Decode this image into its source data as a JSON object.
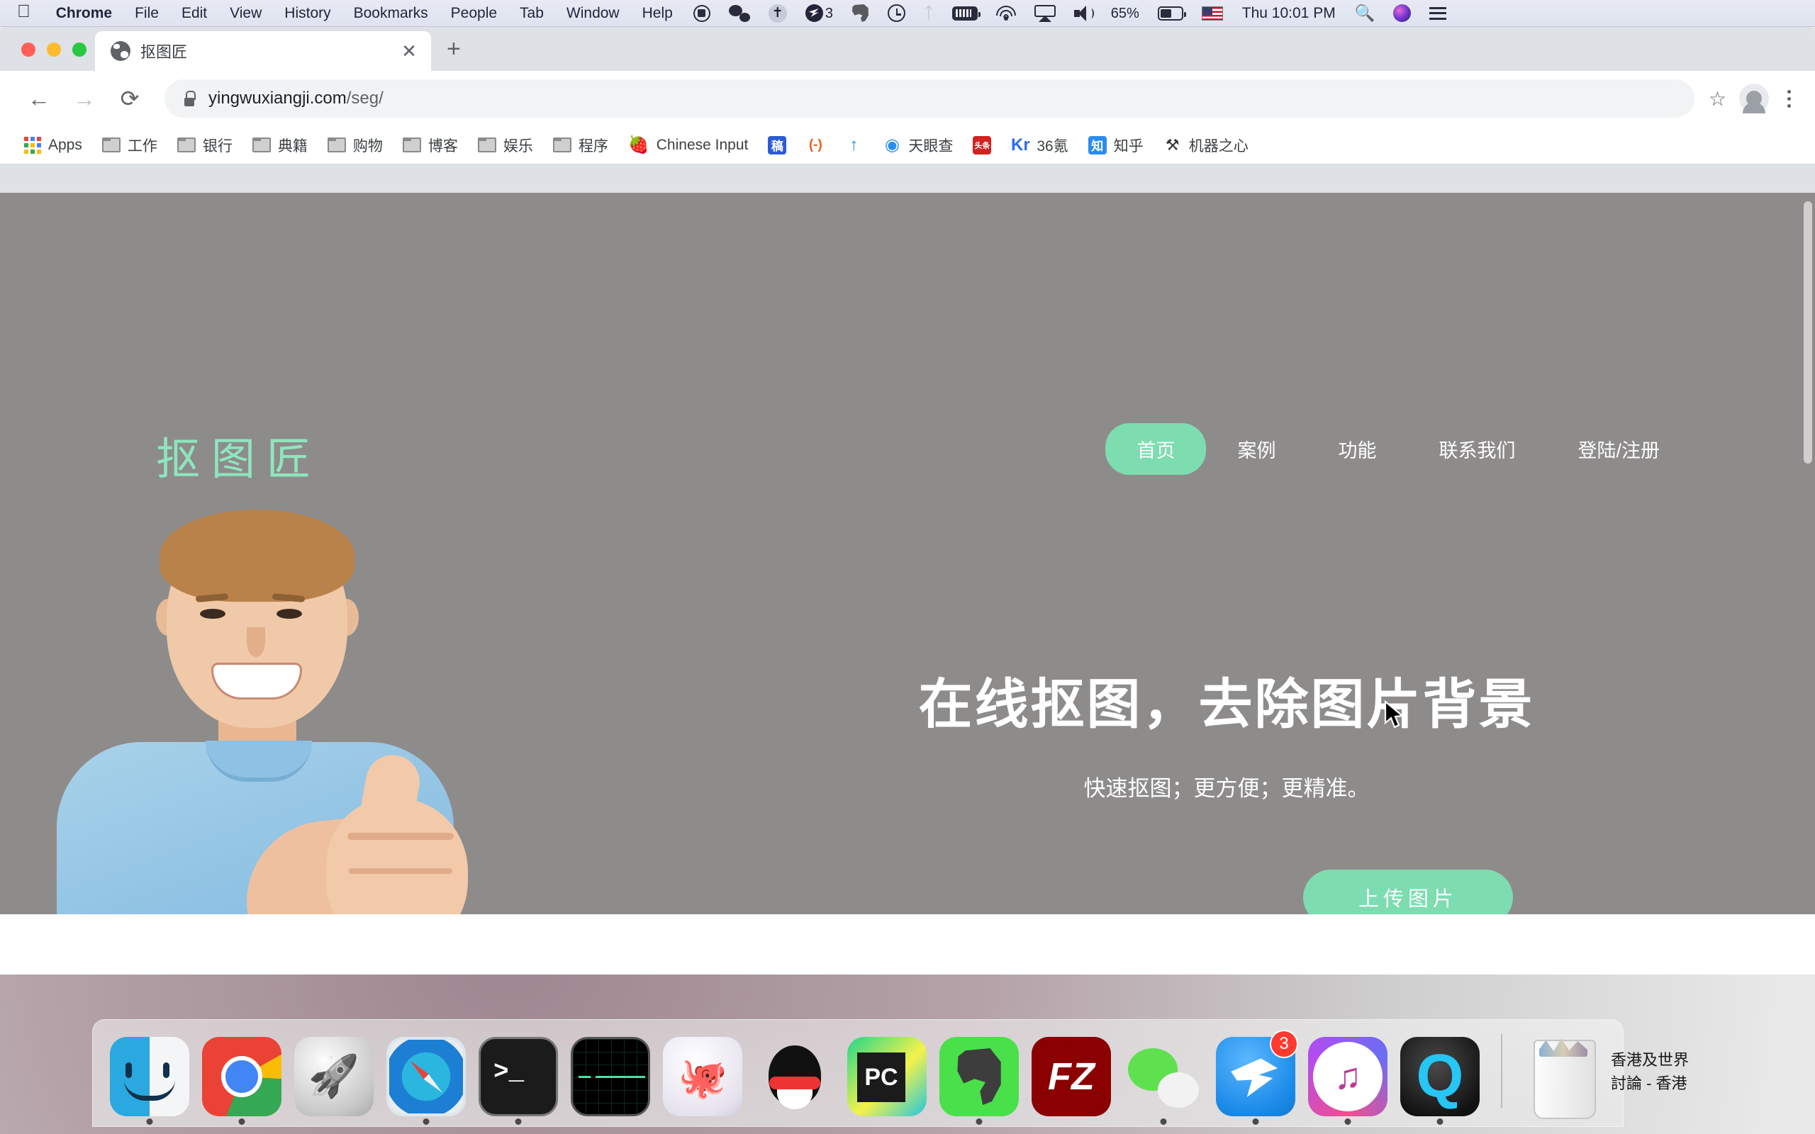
{
  "menubar": {
    "apple_icon": "apple-logo",
    "items": [
      {
        "label": "Chrome",
        "bold": true
      },
      {
        "label": "File",
        "bold": false
      },
      {
        "label": "Edit",
        "bold": false
      },
      {
        "label": "View",
        "bold": false
      },
      {
        "label": "History",
        "bold": false
      },
      {
        "label": "Bookmarks",
        "bold": false
      },
      {
        "label": "People",
        "bold": false
      },
      {
        "label": "Tab",
        "bold": false
      },
      {
        "label": "Window",
        "bold": false
      },
      {
        "label": "Help",
        "bold": false
      }
    ],
    "status_icons": [
      "screen-record-icon",
      "wechat-icon",
      "dropbox-icon",
      "shadowsocks-icon",
      "evernote-icon",
      "time-machine-icon",
      "bluetooth-icon",
      "coconut-battery-icon",
      "wifi-icon",
      "airplay-icon",
      "volume-icon"
    ],
    "shadowsocks_badge": "3",
    "battery_percent": "65%",
    "input_source": "us-flag-icon",
    "clock": "Thu 10:01 PM",
    "search_icon": "spotlight-search-icon",
    "siri_icon": "siri-icon",
    "notification_icon": "notification-center-icon"
  },
  "browser": {
    "window_controls": [
      "close-button",
      "minimize-button",
      "maximize-button"
    ],
    "tab": {
      "favicon": "globe-favicon",
      "title": "抠图匠",
      "close_label": "✕"
    },
    "new_tab_label": "+",
    "toolbar": {
      "back_label": "←",
      "forward_label": "→",
      "reload_label": "⟳",
      "lock_icon": "padlock-icon",
      "url_domain": "yingwuxiangji.com",
      "url_path": "/seg/",
      "bookmark_star": "☆",
      "profile_icon": "profile-avatar-icon",
      "menu_icon": "three-dot-menu-icon"
    },
    "bookmarks": [
      {
        "label": "Apps",
        "icon": "apps-grid-icon",
        "type": "apps"
      },
      {
        "label": "工作",
        "icon": "folder-icon",
        "type": "folder"
      },
      {
        "label": "银行",
        "icon": "folder-icon",
        "type": "folder"
      },
      {
        "label": "典籍",
        "icon": "folder-icon",
        "type": "folder"
      },
      {
        "label": "购物",
        "icon": "folder-icon",
        "type": "folder"
      },
      {
        "label": "博客",
        "icon": "folder-icon",
        "type": "folder"
      },
      {
        "label": "娱乐",
        "icon": "folder-icon",
        "type": "folder"
      },
      {
        "label": "程序",
        "icon": "folder-icon",
        "type": "folder"
      },
      {
        "label": "Chinese Input",
        "icon": "strawberry-icon",
        "type": "emoji",
        "glyph": "🍓"
      },
      {
        "label": "",
        "icon": "gao-square-icon",
        "type": "square",
        "glyph": "稿",
        "bg": "#2b5cd6"
      },
      {
        "label": "",
        "icon": "bracket-icon",
        "type": "square",
        "glyph": "(-)",
        "bg": "#ffffff",
        "fg": "#e8601c"
      },
      {
        "label": "",
        "icon": "blue-arrow-icon",
        "type": "square",
        "glyph": "↑",
        "bg": "#ffffff",
        "fg": "#2b8cf0"
      },
      {
        "label": "天眼查",
        "icon": "tianyancha-icon",
        "type": "square",
        "glyph": "◉",
        "bg": "#ffffff",
        "fg": "#2b8cf0"
      },
      {
        "label": "",
        "icon": "toutiao-icon",
        "type": "square",
        "glyph": "头条",
        "bg": "#d32020"
      },
      {
        "label": "36氪",
        "icon": "kr36-icon",
        "type": "square",
        "glyph": "Kr",
        "bg": "#ffffff",
        "fg": "#2b6cf0"
      },
      {
        "label": "知乎",
        "icon": "zhihu-icon",
        "type": "square",
        "glyph": "知",
        "bg": "#2b8cf0"
      },
      {
        "label": "机器之心",
        "icon": "jiqizhixin-icon",
        "type": "square",
        "glyph": "⚒",
        "bg": "#ffffff",
        "fg": "#333333"
      }
    ]
  },
  "page": {
    "logo": "抠图匠",
    "nav": [
      {
        "label": "首页",
        "active": true
      },
      {
        "label": "案例",
        "active": false
      },
      {
        "label": "功能",
        "active": false
      },
      {
        "label": "联系我们",
        "active": false
      },
      {
        "label": "登陆/注册",
        "active": false
      }
    ],
    "hero_title": "在线抠图，去除图片背景",
    "hero_subtitle": "快速抠图；更方便；更精准。",
    "upload_button": "上传图片",
    "hero_image_alt": "man-thumbs-up-photo",
    "colors": {
      "accent": "#7ddcb0",
      "logo": "#8de6bd",
      "hero_background": "#8e8b8b"
    }
  },
  "dock": {
    "apps": [
      {
        "name": "Finder",
        "running": true,
        "badge": ""
      },
      {
        "name": "Google Chrome",
        "running": true,
        "badge": ""
      },
      {
        "name": "Launchpad",
        "running": false,
        "badge": ""
      },
      {
        "name": "Safari",
        "running": true,
        "badge": ""
      },
      {
        "name": "Terminal",
        "running": true,
        "badge": ""
      },
      {
        "name": "Activity Monitor",
        "running": false,
        "badge": ""
      },
      {
        "name": "GitHub Desktop",
        "running": false,
        "badge": ""
      },
      {
        "name": "QQ",
        "running": false,
        "badge": ""
      },
      {
        "name": "PyCharm",
        "running": false,
        "badge": ""
      },
      {
        "name": "Evernote",
        "running": true,
        "badge": ""
      },
      {
        "name": "FileZilla",
        "running": false,
        "badge": ""
      },
      {
        "name": "WeChat",
        "running": true,
        "badge": ""
      },
      {
        "name": "Tweetbot",
        "running": true,
        "badge": "3"
      },
      {
        "name": "iTunes",
        "running": true,
        "badge": ""
      },
      {
        "name": "QuickTime Player",
        "running": true,
        "badge": ""
      }
    ],
    "trash": "Trash",
    "stack_label_line1": "香港及世界",
    "stack_label_line2": "討論 - 香港"
  }
}
